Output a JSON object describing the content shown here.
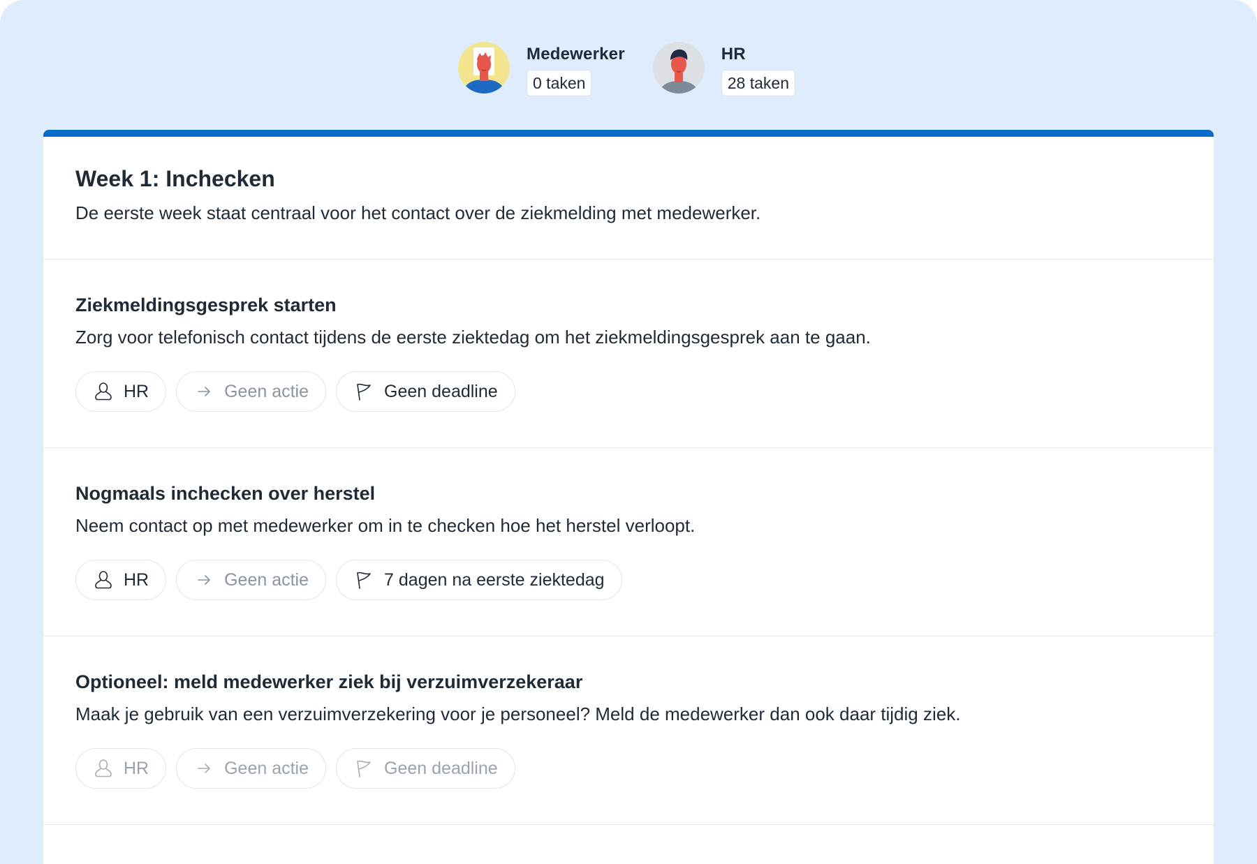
{
  "assignees": [
    {
      "name": "Medewerker",
      "tasks": "0 taken"
    },
    {
      "name": "HR",
      "tasks": "28 taken"
    }
  ],
  "week": {
    "title": "Week 1: Inchecken",
    "description": "De eerste week staat centraal voor het contact over de ziekmelding met medewerker."
  },
  "tasks": [
    {
      "title": "Ziekmeldingsgesprek starten",
      "description": "Zorg voor telefonisch contact tijdens de eerste ziektedag om het ziekmeldingsgesprek aan te gaan.",
      "assignee": "HR",
      "action": "Geen actie",
      "deadline": "Geen deadline"
    },
    {
      "title": "Nogmaals inchecken over herstel",
      "description": "Neem contact op met medewerker om in te checken hoe het herstel verloopt.",
      "assignee": "HR",
      "action": "Geen actie",
      "deadline": "7 dagen na eerste ziektedag"
    },
    {
      "title": "Optioneel: meld medewerker ziek bij verzuimverzekeraar",
      "description": "Maak je gebruik van een verzuimverzekering voor je personeel? Meld de medewerker dan ook daar tijdig ziek.",
      "assignee": "HR",
      "action": "Geen actie",
      "deadline": "Geen deadline"
    }
  ],
  "icons": {
    "assignee": "user-icon",
    "action": "arrow-right-icon",
    "deadline": "flag-icon"
  },
  "colors": {
    "background": "#dfecfb",
    "accent": "#0b6bc9",
    "text": "#1f2a37",
    "muted": "#8a94a0",
    "avatar_employee_bg": "#f3e58f",
    "avatar_hr_bg": "#dcdfe4"
  }
}
